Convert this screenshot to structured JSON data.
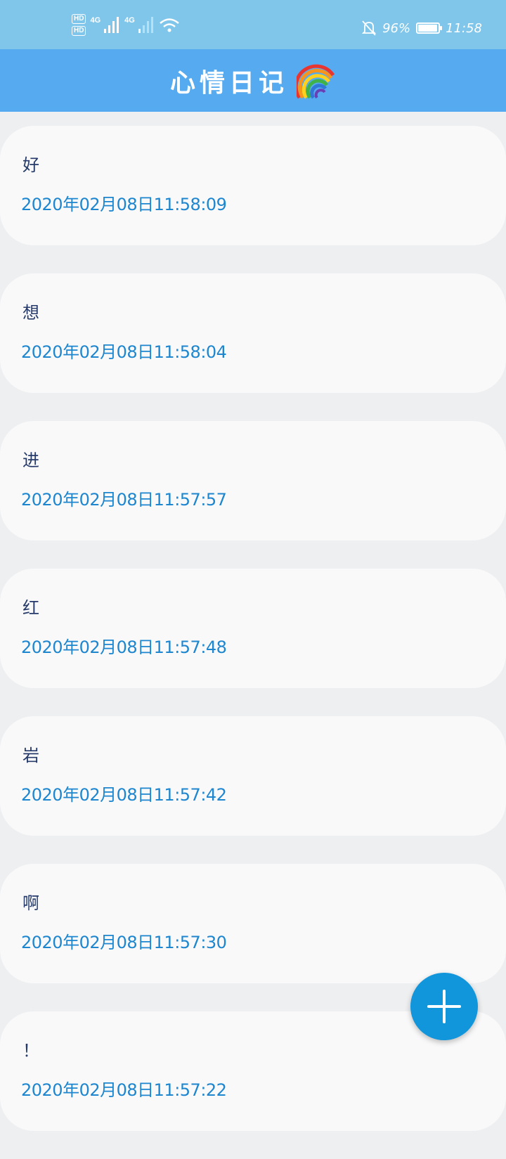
{
  "status_bar": {
    "hd1": "HD",
    "hd2": "HD",
    "net1": "4G",
    "net2": "4G",
    "battery_text": "96%",
    "battery_level": 0.96,
    "time": "11:58"
  },
  "app_bar": {
    "title": "心情日记",
    "emoji": "🌈"
  },
  "entries": [
    {
      "title": "好",
      "date": "2020年02月08日11:58:09"
    },
    {
      "title": "想",
      "date": "2020年02月08日11:58:04"
    },
    {
      "title": "进",
      "date": "2020年02月08日11:57:57"
    },
    {
      "title": "红",
      "date": "2020年02月08日11:57:48"
    },
    {
      "title": "岩",
      "date": "2020年02月08日11:57:42"
    },
    {
      "title": "啊",
      "date": "2020年02月08日11:57:30"
    },
    {
      "title": "！",
      "date": "2020年02月08日11:57:22"
    }
  ],
  "fab": {
    "icon": "plus-icon"
  },
  "colors": {
    "status_bar": "#7fc6ea",
    "app_bar": "#55aaf0",
    "date_text": "#1d86cf",
    "fab": "#1296db"
  }
}
